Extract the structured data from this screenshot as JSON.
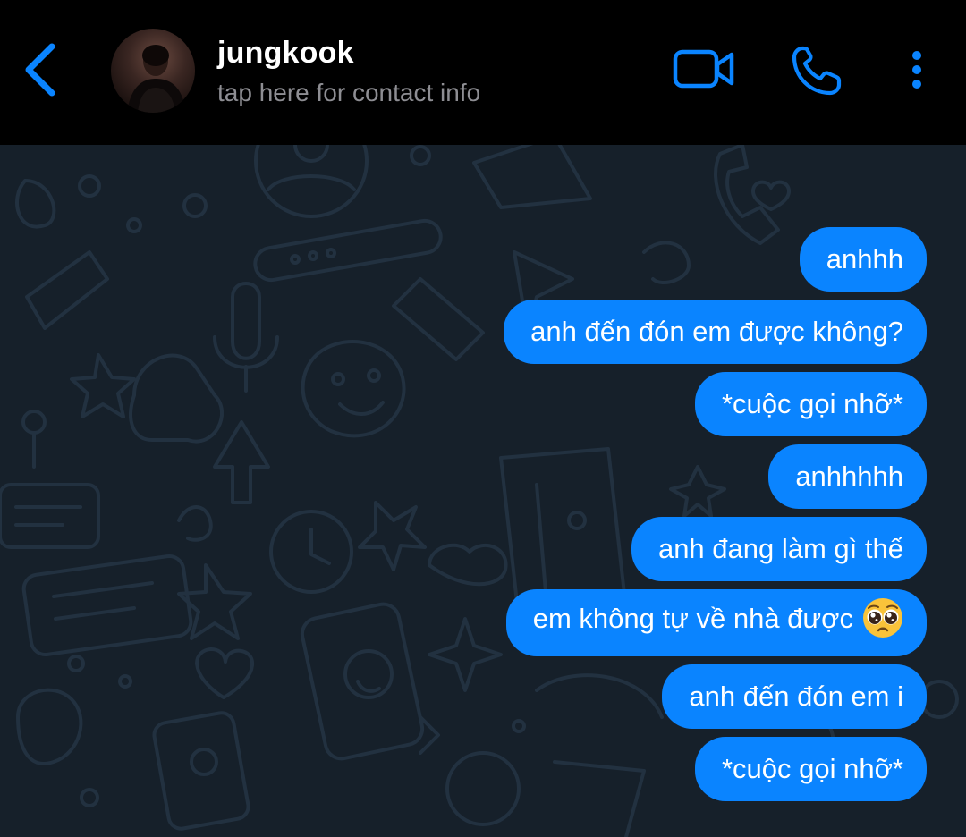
{
  "header": {
    "back_icon": "chevron-left-icon",
    "contact_name": "jungkook",
    "contact_subtitle": "tap here for contact info",
    "video_icon": "video-camera-icon",
    "call_icon": "phone-icon",
    "more_icon": "more-vertical-icon",
    "accent_color": "#0a84ff"
  },
  "chat": {
    "background_color": "#16202a",
    "bubble_color": "#0a84ff",
    "messages": [
      {
        "text": "anhhh",
        "sender": "me"
      },
      {
        "text": "anh đến đón em được không?",
        "sender": "me"
      },
      {
        "text": "*cuộc gọi nhỡ*",
        "sender": "me"
      },
      {
        "text": "anhhhhh",
        "sender": "me"
      },
      {
        "text": "anh đang làm gì thế",
        "sender": "me"
      },
      {
        "text": "em không tự về nhà được",
        "sender": "me",
        "emoji": "pleading-face-emoji"
      },
      {
        "text": "anh đến đón em i",
        "sender": "me"
      },
      {
        "text": "*cuộc gọi nhỡ*",
        "sender": "me"
      }
    ]
  }
}
